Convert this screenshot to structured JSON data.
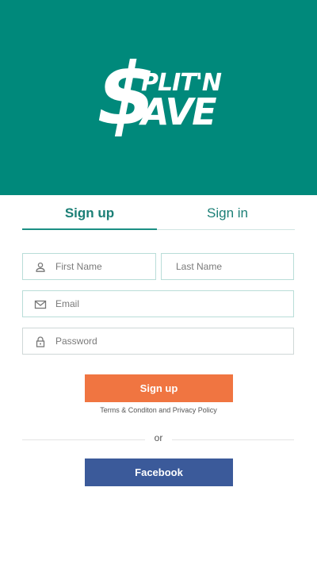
{
  "header": {
    "logo_s": "$",
    "logo_line1": "PLIT'N",
    "logo_line2": "AVE",
    "background": "#00897b"
  },
  "tabs": [
    {
      "label": "Sign up",
      "active": true
    },
    {
      "label": "Sign in",
      "active": false
    }
  ],
  "form": {
    "first_name": {
      "placeholder": "First Name",
      "value": "",
      "icon": "person-icon"
    },
    "last_name": {
      "placeholder": "Last Name",
      "value": ""
    },
    "email": {
      "placeholder": "Email",
      "value": "",
      "icon": "mail-icon"
    },
    "password": {
      "placeholder": "Password",
      "value": "",
      "icon": "lock-icon"
    }
  },
  "signup_button": {
    "label": "Sign up",
    "color": "#f07541"
  },
  "terms_text": "Terms & Conditon and Privacy Policy",
  "divider_text": "or",
  "facebook_button": {
    "label": "Facebook",
    "color": "#3b5a9a"
  }
}
